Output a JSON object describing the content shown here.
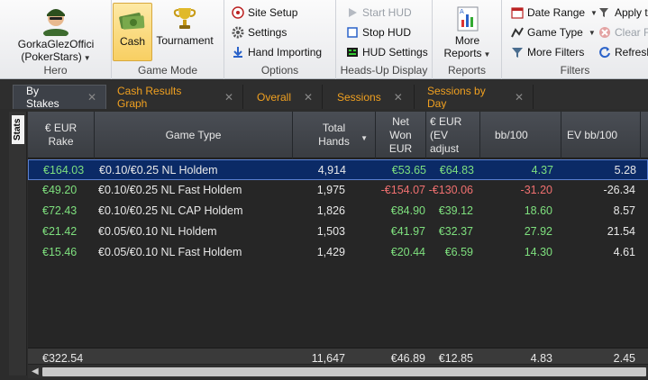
{
  "ribbon": {
    "hero": {
      "name_line1": "GorkaGlezOffici",
      "name_line2": "(PokerStars)",
      "group_label": "Hero"
    },
    "game_mode": {
      "cash_label": "Cash",
      "tournament_label": "Tournament",
      "group_label": "Game Mode"
    },
    "options": {
      "site_setup": "Site Setup",
      "settings": "Settings",
      "hand_importing": "Hand Importing",
      "group_label": "Options"
    },
    "hud": {
      "start_hud": "Start HUD",
      "stop_hud": "Stop HUD",
      "hud_settings": "HUD Settings",
      "group_label": "Heads-Up Display"
    },
    "reports": {
      "more_line1": "More",
      "more_line2": "Reports",
      "group_label": "Reports"
    },
    "filters": {
      "date_range": "Date Range",
      "game_type": "Game Type",
      "more_filters": "More Filters",
      "apply": "Apply t",
      "clear": "Clear Fi",
      "refresh": "Refresh",
      "group_label": "Filters"
    }
  },
  "tabs": [
    {
      "label": "By Stakes",
      "active": true
    },
    {
      "label": "Cash Results Graph",
      "active": false
    },
    {
      "label": "Overall",
      "active": false
    },
    {
      "label": "Sessions",
      "active": false
    },
    {
      "label": "Sessions by Day",
      "active": false
    }
  ],
  "stats_label": "Stats",
  "table": {
    "columns": [
      "€ EUR\nRake",
      "Game Type",
      "Total\nHands",
      "Net\nWon\nEUR",
      "€ EUR\n(EV\nadjust",
      "bb/100",
      "EV bb/100"
    ],
    "rows": [
      [
        "€164.03",
        "€0.10/€0.25 NL Holdem",
        "4,914",
        "€53.65",
        "€64.83",
        "4.37",
        "5.28"
      ],
      [
        "€49.20",
        "€0.10/€0.25 NL Fast Holdem",
        "1,975",
        "-€154.07",
        "-€130.06",
        "-31.20",
        "-26.34"
      ],
      [
        "€72.43",
        "€0.10/€0.25 NL CAP Holdem",
        "1,826",
        "€84.90",
        "€39.12",
        "18.60",
        "8.57"
      ],
      [
        "€21.42",
        "€0.05/€0.10 NL Holdem",
        "1,503",
        "€41.97",
        "€32.37",
        "27.92",
        "21.54"
      ],
      [
        "€15.46",
        "€0.05/€0.10 NL Fast Holdem",
        "1,429",
        "€20.44",
        "€6.59",
        "14.30",
        "4.61"
      ]
    ],
    "totals": [
      "€322.54",
      "",
      "11,647",
      "€46.89",
      "€12.85",
      "4.83",
      "2.45"
    ]
  },
  "colors": {
    "positive": "#7ee07e",
    "negative": "#f07070",
    "tab_accent": "#f0a020",
    "selection": "#0b2a66"
  }
}
